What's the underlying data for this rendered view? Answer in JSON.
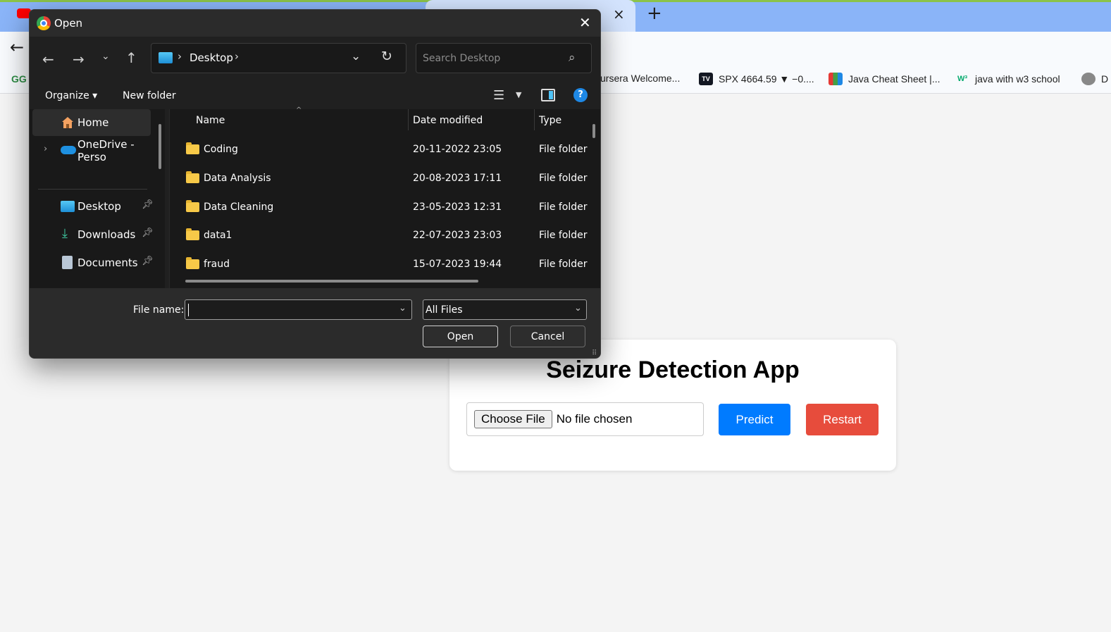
{
  "browser": {
    "new_tab_label": "+",
    "close_tab_label": "×",
    "back_label": "←",
    "bookmarks": [
      {
        "label": "ursera Welcome...",
        "icon": "coursera-icon"
      },
      {
        "label": "SPX 4664.59 ▼ −0....",
        "icon": "tradingview-icon",
        "icon_text": "TV"
      },
      {
        "label": "Java Cheat Sheet |...",
        "icon": "cheatsheet-icon"
      },
      {
        "label": "java with w3 school",
        "icon": "w3schools-icon",
        "icon_text": "W³"
      },
      {
        "label": "D",
        "icon": "github-icon"
      }
    ],
    "gfg_label": "GG"
  },
  "app": {
    "title": "Seizure Detection App",
    "choose_file_label": "Choose File",
    "no_file_text": "No file chosen",
    "predict_label": "Predict",
    "restart_label": "Restart",
    "colors": {
      "predict": "#007bff",
      "restart": "#e74c3c"
    }
  },
  "dialog": {
    "title": "Open",
    "close_label": "✕",
    "address": {
      "location": "Desktop",
      "sep": "›"
    },
    "search_placeholder": "Search Desktop",
    "organize_label": "Organize ▾",
    "new_folder_label": "New folder",
    "help_label": "?",
    "nav": {
      "home": "Home",
      "onedrive": "OneDrive - Perso",
      "desktop": "Desktop",
      "downloads": "Downloads",
      "documents": "Documents"
    },
    "columns": {
      "name": "Name",
      "date": "Date modified",
      "type": "Type"
    },
    "files": [
      {
        "name": "Coding",
        "date": "20-11-2022 23:05",
        "type": "File folder"
      },
      {
        "name": "Data Analysis",
        "date": "20-08-2023 17:11",
        "type": "File folder"
      },
      {
        "name": "Data Cleaning",
        "date": "23-05-2023 12:31",
        "type": "File folder"
      },
      {
        "name": "data1",
        "date": "22-07-2023 23:03",
        "type": "File folder"
      },
      {
        "name": "fraud",
        "date": "15-07-2023 19:44",
        "type": "File folder"
      }
    ],
    "file_name_label": "File name:",
    "file_name_value": "",
    "filter_value": "All Files",
    "open_label": "Open",
    "cancel_label": "Cancel"
  }
}
